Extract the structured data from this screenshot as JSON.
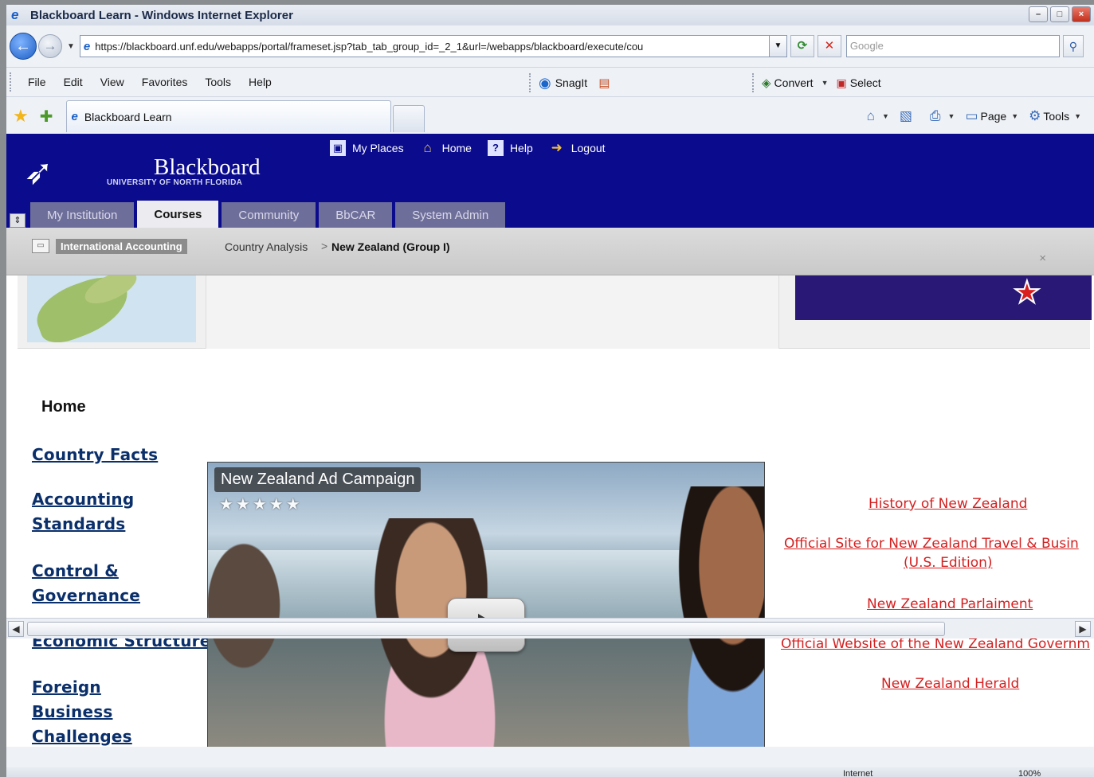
{
  "window": {
    "title": "Blackboard Learn - Windows Internet Explorer"
  },
  "addressbar": {
    "url": "https://blackboard.unf.edu/webapps/portal/frameset.jsp?tab_tab_group_id=_2_1&url=/webapps/blackboard/execute/cou",
    "search_placeholder": "Google"
  },
  "menubar": {
    "items": [
      "File",
      "Edit",
      "View",
      "Favorites",
      "Tools",
      "Help"
    ],
    "snagit": "SnagIt",
    "convert": "Convert",
    "select": "Select"
  },
  "favbar": {
    "tab_title": "Blackboard Learn",
    "page_label": "Page",
    "tools_label": "Tools"
  },
  "bb": {
    "title": "Blackboard",
    "subtitle": "UNIVERSITY OF NORTH FLORIDA",
    "toplinks": [
      "My Places",
      "Home",
      "Help",
      "Logout"
    ],
    "tabs": [
      "My Institution",
      "Courses",
      "Community",
      "BbCAR",
      "System Admin"
    ],
    "active_tab": "Courses"
  },
  "breadcrumb": {
    "course": "International Accounting",
    "section": "Country Analysis",
    "separator": ">",
    "current": "New Zealand (Group I)",
    "close": "×"
  },
  "nav": {
    "home": "Home",
    "links": [
      "Country Facts",
      "Accounting Standards",
      "Control & Governance",
      "Economic Structure",
      "Foreign Business Challenges"
    ]
  },
  "video": {
    "title": "New Zealand Ad Campaign",
    "rating": "★★★★★"
  },
  "links": [
    "History of New Zealand",
    "Official Site for New Zealand Travel & Busin",
    "(U.S. Edition)",
    "New Zealand Parlaiment",
    "Official Website of the New Zealand Governm",
    "New Zealand Herald"
  ],
  "colors": {
    "bb_header": "#0b0b8e",
    "link_red": "#d42020",
    "nav_link": "#0a2f6a"
  },
  "status": {
    "zone": "Internet",
    "zoom": "100%"
  }
}
